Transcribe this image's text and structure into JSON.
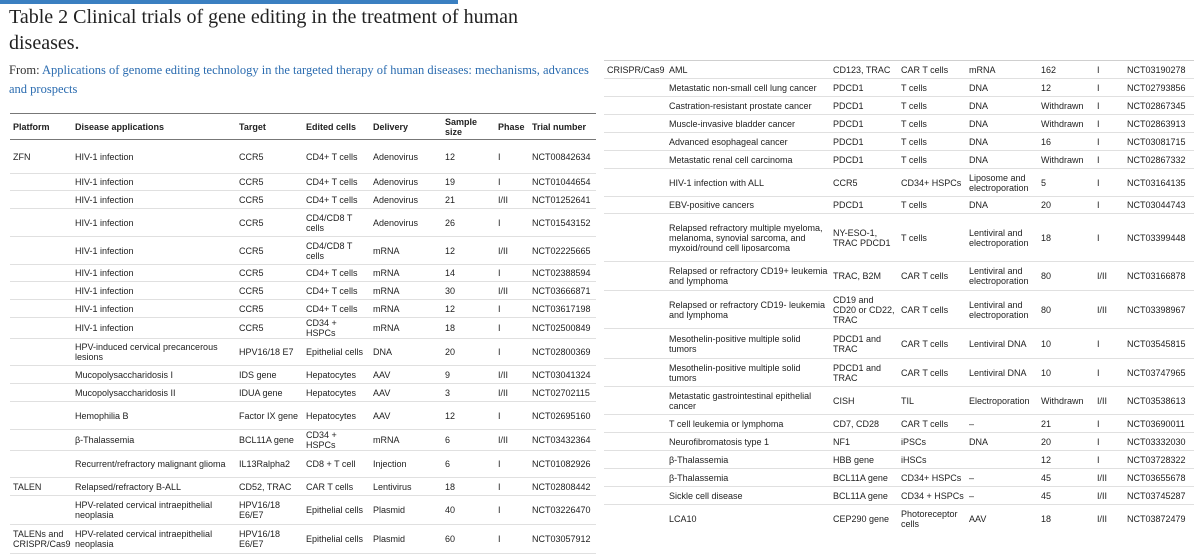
{
  "title": "Table 2 Clinical trials of gene editing in the treatment of human diseases.",
  "from_label": "From:",
  "from_link": "Applications of genome editing technology in the targeted therapy of human diseases: mechanisms, advances and prospects",
  "columns": [
    "Platform",
    "Disease applications",
    "Target",
    "Edited cells",
    "Delivery",
    "Sample size",
    "Phase",
    "Trial number"
  ],
  "left_rows": [
    {
      "h": 34,
      "c": [
        "ZFN",
        "HIV-1 infection",
        "CCR5",
        "CD4+ T cells",
        "Adenovirus",
        "12",
        "I",
        "NCT00842634"
      ]
    },
    {
      "h": 17,
      "c": [
        "",
        "HIV-1 infection",
        "CCR5",
        "CD4+ T cells",
        "Adenovirus",
        "19",
        "I",
        "NCT01044654"
      ]
    },
    {
      "h": 18,
      "c": [
        "",
        "HIV-1 infection",
        "CCR5",
        "CD4+ T cells",
        "Adenovirus",
        "21",
        "I/II",
        "NCT01252641"
      ]
    },
    {
      "h": 28,
      "c": [
        "",
        "HIV-1 infection",
        "CCR5",
        "CD4/CD8 T cells",
        "Adenovirus",
        "26",
        "I",
        "NCT01543152"
      ]
    },
    {
      "h": 28,
      "c": [
        "",
        "HIV-1 infection",
        "CCR5",
        "CD4/CD8 T cells",
        "mRNA",
        "12",
        "I/II",
        "NCT02225665"
      ]
    },
    {
      "h": 17,
      "c": [
        "",
        "HIV-1 infection",
        "CCR5",
        "CD4+ T cells",
        "mRNA",
        "14",
        "I",
        "NCT02388594"
      ]
    },
    {
      "h": 18,
      "c": [
        "",
        "HIV-1 infection",
        "CCR5",
        "CD4+ T cells",
        "mRNA",
        "30",
        "I/II",
        "NCT03666871"
      ]
    },
    {
      "h": 18,
      "c": [
        "",
        "HIV-1 infection",
        "CCR5",
        "CD4+ T cells",
        "mRNA",
        "12",
        "I",
        "NCT03617198"
      ]
    },
    {
      "h": 18,
      "c": [
        "",
        "HIV-1 infection",
        "CCR5",
        "CD34 + HSPCs",
        "mRNA",
        "18",
        "I",
        "NCT02500849"
      ]
    },
    {
      "h": 27,
      "c": [
        "",
        "HPV-induced cervical precancerous lesions",
        "HPV16/18 E7",
        "Epithelial cells",
        "DNA",
        "20",
        "I",
        "NCT02800369"
      ]
    },
    {
      "h": 18,
      "c": [
        "",
        "Mucopolysaccharidosis I",
        "IDS gene",
        "Hepatocytes",
        "AAV",
        "9",
        "I/II",
        "NCT03041324"
      ]
    },
    {
      "h": 18,
      "c": [
        "",
        "Mucopolysaccharidosis II",
        "IDUA gene",
        "Hepatocytes",
        "AAV",
        "3",
        "I/II",
        "NCT02702115"
      ]
    },
    {
      "h": 28,
      "c": [
        "",
        "Hemophilia B",
        "Factor IX gene",
        "Hepatocytes",
        "AAV",
        "12",
        "I",
        "NCT02695160"
      ]
    },
    {
      "h": 18,
      "c": [
        "",
        "β-Thalassemia",
        "BCL11A gene",
        "CD34 + HSPCs",
        "mRNA",
        "6",
        "I/II",
        "NCT03432364"
      ]
    },
    {
      "h": 27,
      "c": [
        "",
        "Recurrent/refractory malignant glioma",
        "IL13Ralpha2",
        "CD8 + T cell",
        "Injection",
        "6",
        "I",
        "NCT01082926"
      ]
    },
    {
      "h": 18,
      "c": [
        "TALEN",
        "Relapsed/refractory B-ALL",
        "CD52, TRAC",
        "CAR T cells",
        "Lentivirus",
        "18",
        "I",
        "NCT02808442"
      ]
    },
    {
      "h": 29,
      "c": [
        "",
        "HPV-related cervical intraepithelial neoplasia",
        "HPV16/18 E6/E7",
        "Epithelial cells",
        "Plasmid",
        "40",
        "I",
        "NCT03226470"
      ]
    },
    {
      "h": 29,
      "c": [
        "TALENs and CRISPR/Cas9",
        "HPV-related cervical intraepithelial neoplasia",
        "HPV16/18 E6/E7",
        "Epithelial cells",
        "Plasmid",
        "60",
        "I",
        "NCT03057912"
      ]
    }
  ],
  "right_rows": [
    {
      "h": 18,
      "c": [
        "CRISPR/Cas9",
        "AML",
        "CD123, TRAC",
        "CAR T cells",
        "mRNA",
        "162",
        "I",
        "NCT03190278"
      ]
    },
    {
      "h": 18,
      "c": [
        "",
        "Metastatic non-small cell lung cancer",
        "PDCD1",
        "T cells",
        "DNA",
        "12",
        "I",
        "NCT02793856"
      ]
    },
    {
      "h": 18,
      "c": [
        "",
        "Castration-resistant prostate cancer",
        "PDCD1",
        "T cells",
        "DNA",
        "Withdrawn",
        "I",
        "NCT02867345"
      ]
    },
    {
      "h": 18,
      "c": [
        "",
        "Muscle-invasive bladder cancer",
        "PDCD1",
        "T cells",
        "DNA",
        "Withdrawn",
        "I",
        "NCT02863913"
      ]
    },
    {
      "h": 18,
      "c": [
        "",
        "Advanced esophageal cancer",
        "PDCD1",
        "T cells",
        "DNA",
        "16",
        "I",
        "NCT03081715"
      ]
    },
    {
      "h": 18,
      "c": [
        "",
        "Metastatic renal cell carcinoma",
        "PDCD1",
        "T cells",
        "DNA",
        "Withdrawn",
        "I",
        "NCT02867332"
      ]
    },
    {
      "h": 28,
      "c": [
        "",
        "HIV-1 infection with ALL",
        "CCR5",
        "CD34+ HSPCs",
        "Liposome and electroporation",
        "5",
        "I",
        "NCT03164135"
      ]
    },
    {
      "h": 17,
      "c": [
        "",
        "EBV-positive cancers",
        "PDCD1",
        "T cells",
        "DNA",
        "20",
        "I",
        "NCT03044743"
      ]
    },
    {
      "h": 48,
      "c": [
        "",
        "Relapsed refractory multiple myeloma, melanoma, synovial sarcoma, and myxoid/round cell liposarcoma",
        "NY-ESO-1, TRAC PDCD1",
        "T cells",
        "Lentiviral and electroporation",
        "18",
        "I",
        "NCT03399448"
      ]
    },
    {
      "h": 29,
      "c": [
        "",
        "Relapsed or refractory CD19+ leukemia and lymphoma",
        "TRAC, B2M",
        "CAR T cells",
        "Lentiviral and electroporation",
        "80",
        "I/II",
        "NCT03166878"
      ]
    },
    {
      "h": 38,
      "c": [
        "",
        "Relapsed or refractory CD19- leukemia and lymphoma",
        "CD19 and CD20 or CD22, TRAC",
        "CAR T cells",
        "Lentiviral and electroporation",
        "80",
        "I/II",
        "NCT03398967"
      ]
    },
    {
      "h": 30,
      "c": [
        "",
        "Mesothelin-positive multiple solid tumors",
        "PDCD1 and TRAC",
        "CAR T cells",
        "Lentiviral DNA",
        "10",
        "I",
        "NCT03545815"
      ]
    },
    {
      "h": 28,
      "c": [
        "",
        "Mesothelin-positive multiple solid tumors",
        "PDCD1 and TRAC",
        "CAR T cells",
        "Lentiviral DNA",
        "10",
        "I",
        "NCT03747965"
      ]
    },
    {
      "h": 28,
      "c": [
        "",
        "Metastatic gastrointestinal epithelial cancer",
        "CISH",
        "TIL",
        "Electroporation",
        "Withdrawn",
        "I/II",
        "NCT03538613"
      ]
    },
    {
      "h": 18,
      "c": [
        "",
        "T cell leukemia or lymphoma",
        "CD7, CD28",
        "CAR T cells",
        "–",
        "21",
        "I",
        "NCT03690011"
      ]
    },
    {
      "h": 18,
      "c": [
        "",
        "Neurofibromatosis type 1",
        "NF1",
        "iPSCs",
        "DNA",
        "20",
        "I",
        "NCT03332030"
      ]
    },
    {
      "h": 18,
      "c": [
        "",
        "β-Thalassemia",
        "HBB gene",
        "iHSCs",
        "",
        "12",
        "I",
        "NCT03728322"
      ]
    },
    {
      "h": 18,
      "c": [
        "",
        "β-Thalassemia",
        "BCL11A gene",
        "CD34+ HSPCs",
        "–",
        "45",
        "I/II",
        "NCT03655678"
      ]
    },
    {
      "h": 18,
      "c": [
        "",
        "Sickle cell disease",
        "BCL11A gene",
        "CD34 + HSPCs",
        "–",
        "45",
        "I/II",
        "NCT03745287"
      ]
    },
    {
      "h": 28,
      "c": [
        "",
        "LCA10",
        "CEP290 gene",
        "Photoreceptor cells",
        "AAV",
        "18",
        "I/II",
        "NCT03872479"
      ]
    }
  ]
}
